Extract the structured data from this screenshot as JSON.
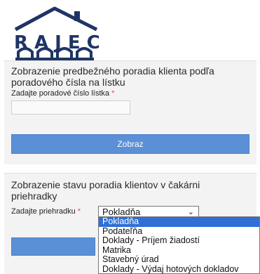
{
  "logo": {
    "text": "RAJEC",
    "color": "#1f3566"
  },
  "ticket_panel": {
    "title": "Zobrazenie predbežného poradia klienta podľa poradového čísla na lístku",
    "ticket_label": "Zadajte poradové číslo lístka",
    "required_mark": "*",
    "ticket_value": "",
    "submit_label": "Zobraz"
  },
  "counter_panel": {
    "title": "Zobrazenie stavu poradia klientov v čakárni priehradky",
    "counter_label": "Zadajte priehradku",
    "required_mark": "*",
    "selected_counter": "Pokladňa",
    "options": [
      "Pokladňa",
      "Podateľňa",
      "Doklady - Príjem žiadostí",
      "Matrika",
      "Stavebný úrad",
      "Doklady - Výdaj hotových dokladov"
    ]
  },
  "colors": {
    "button": "#5b8fd6",
    "highlight": "#2f6fd6",
    "required": "#d9534f"
  }
}
